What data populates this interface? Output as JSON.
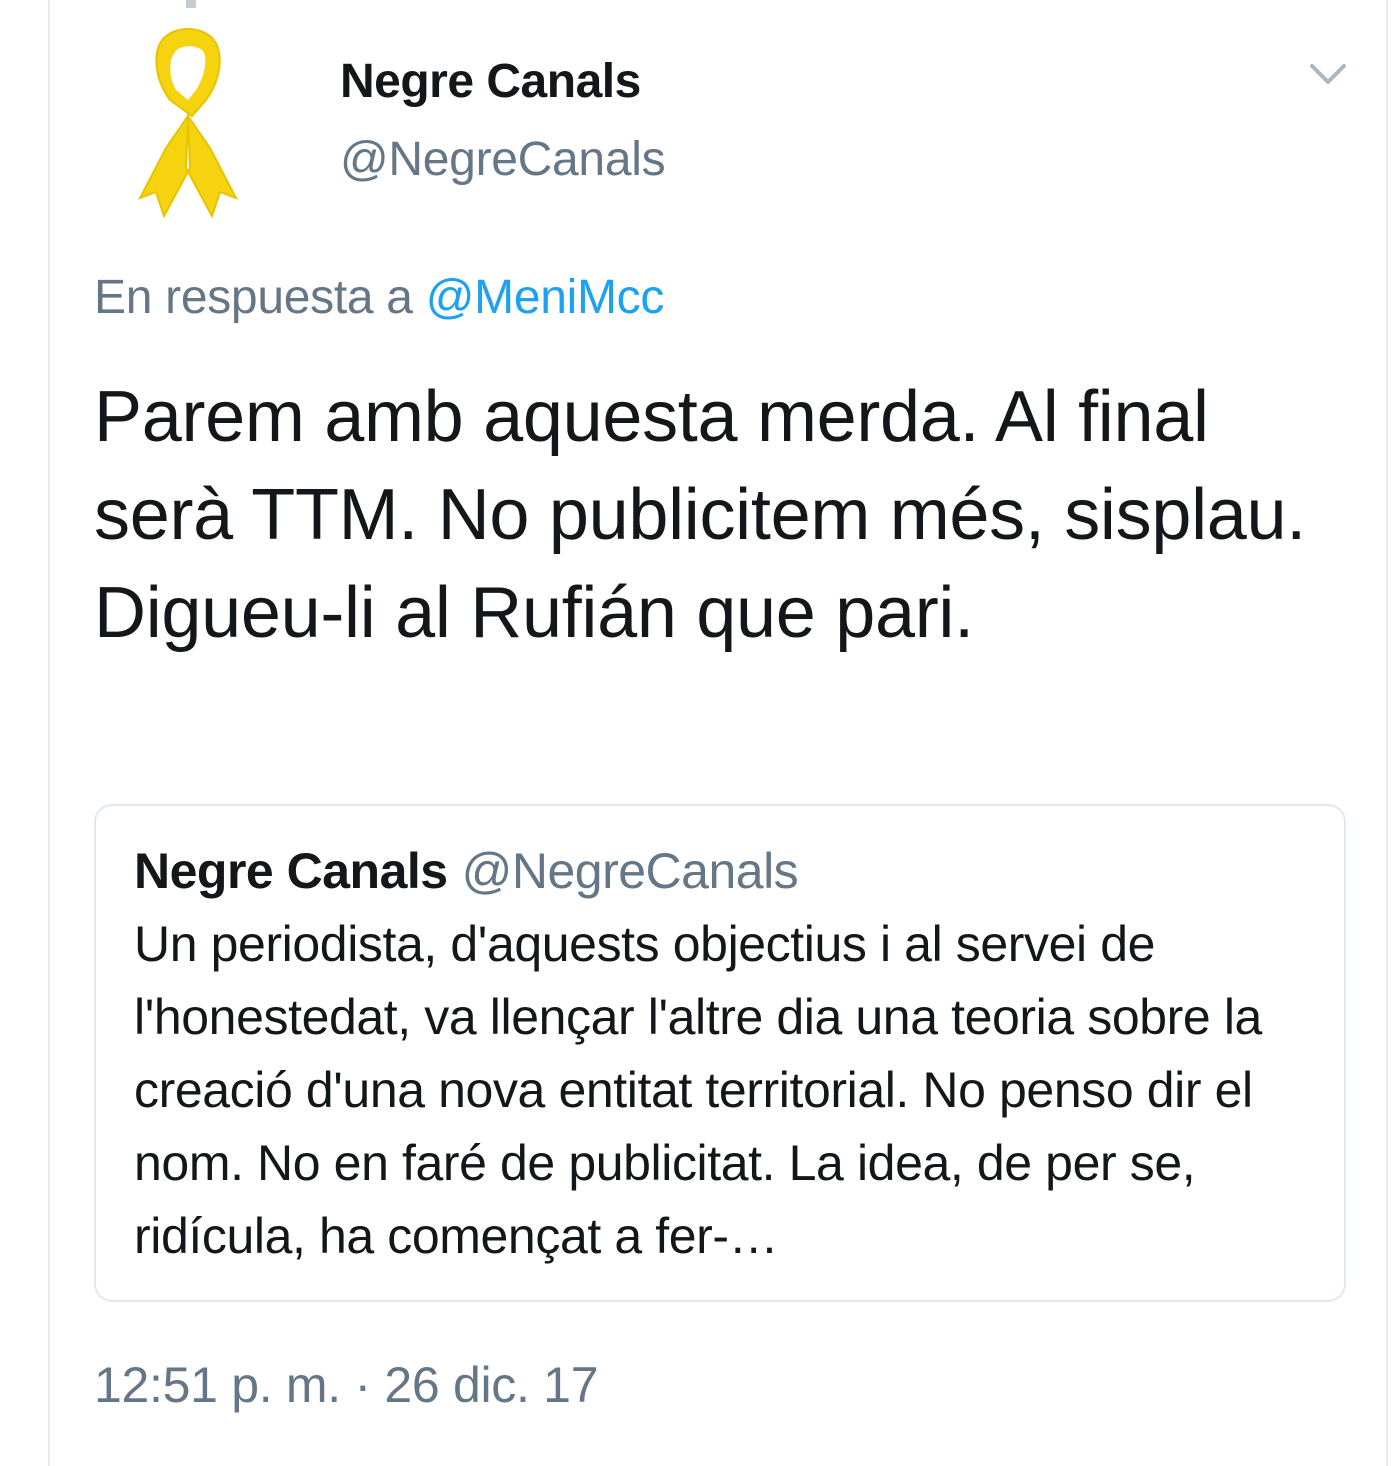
{
  "tweet": {
    "author": {
      "name": "Negre Canals",
      "handle": "@NegreCanals",
      "avatar_icon": "yellow-ribbon-icon"
    },
    "reply_prefix": "En respuesta a",
    "reply_to": "@MeniMcc",
    "text": "Parem amb aquesta merda. Al final serà TTM. No publicitem més, sisplau. Digueu-li al Rufián que pari.",
    "quoted": {
      "name": "Negre Canals",
      "handle": "@NegreCanals",
      "text": "Un periodista, d'aquests objectius i al servei de l'honestedat, va llençar l'altre dia una teoria sobre la creació d'una nova entitat territorial. No penso dir el nom. No en faré de publicitat. La idea, de per se, ridícula, ha començat a fer-…"
    },
    "timestamp": "12:51 p. m. · 26 dic. 17",
    "menu_icon": "chevron-down-icon"
  },
  "colors": {
    "text": "#14171a",
    "secondary": "#657786",
    "link": "#1da1f2",
    "ribbon": "#f5d30f",
    "border": "#e1e8ed"
  }
}
